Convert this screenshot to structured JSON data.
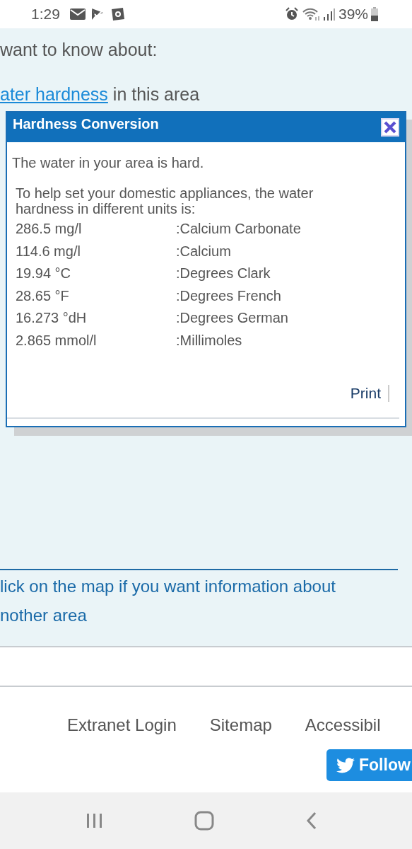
{
  "status_bar": {
    "time": "1:29",
    "battery": "39%"
  },
  "page": {
    "intro": "want to know about:",
    "link": "ater hardness",
    "link_suffix": " in this area",
    "map_hint_lines": [
      "lick on the map if you want information about",
      "nother area"
    ]
  },
  "dialog": {
    "title": "Hardness Conversion",
    "message": "The water in your area is hard.",
    "intro": "To help set your domestic appliances, the water hardness in different units is:",
    "conversions": [
      {
        "value": "286.5 mg/l",
        "unit": ":Calcium Carbonate"
      },
      {
        "value": "114.6 mg/l",
        "unit": ":Calcium"
      },
      {
        "value": "19.94 °C",
        "unit": ":Degrees Clark"
      },
      {
        "value": "28.65 °F",
        "unit": ":Degrees French"
      },
      {
        "value": "16.273 °dH",
        "unit": ":Degrees German"
      },
      {
        "value": "2.865 mmol/l",
        "unit": ":Millimoles"
      }
    ],
    "print": "Print"
  },
  "footer": {
    "links": [
      "Extranet Login",
      "Sitemap",
      "Accessibil"
    ],
    "follow": "Follow"
  }
}
